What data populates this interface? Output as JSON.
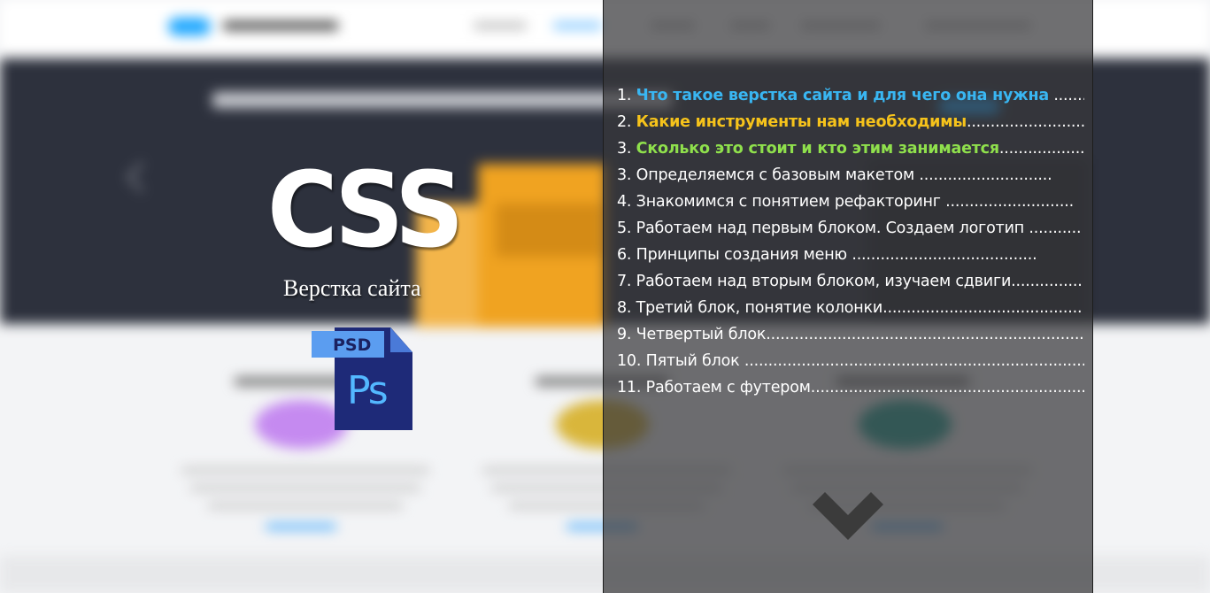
{
  "logo": {
    "title": "CSS",
    "subtitle": "Верстка сайта"
  },
  "psd_icon": {
    "tag": "PSD",
    "label": "Ps",
    "colors": {
      "document": "#1e2a78",
      "tag": "#5b9df0",
      "letters": "#53b8ff"
    }
  },
  "toc": {
    "items": [
      {
        "number": "1.",
        "text": "Что такое верстка сайта и для чего она нужна",
        "dots": " ..............",
        "highlight": "blue"
      },
      {
        "number": "2.",
        "text": "Какие инструменты нам необходимы",
        "dots": "..............................",
        "highlight": "yellow"
      },
      {
        "number": "3.",
        "text": "Сколько это стоит и кто этим занимается",
        "dots": "...................",
        "highlight": "green"
      },
      {
        "number": "3.",
        "text": "Определяемся с базовым макетом",
        "dots": " ............................"
      },
      {
        "number": "4.",
        "text": "Знакомимся с понятием рефакторинг",
        "dots": " ..........................."
      },
      {
        "number": "5.",
        "text": "Работаем над первым блоком. Создаем логотип",
        "dots": " ..........."
      },
      {
        "number": "6.",
        "text": "Принципы создания меню",
        "dots": " ......................................."
      },
      {
        "number": "7.",
        "text": "Работаем над вторым блоком, изучаем сдвиги",
        "dots": "..............."
      },
      {
        "number": "8.",
        "text": "Третий блок, понятие колонки",
        "dots": ".......................................... "
      },
      {
        "number": "9.",
        "text": "Четвертый блок",
        "dots": "........................................................................."
      },
      {
        "number": "10.",
        "text": "Пятый блок",
        "dots": " ..........................................................................."
      },
      {
        "number": "11.",
        "text": "Работаем с футером",
        "dots": "........................................................................"
      }
    ]
  },
  "colors": {
    "highlight_blue": "#39b6f2",
    "highlight_yellow": "#f6c31b",
    "highlight_green": "#8fe04c",
    "panel": "rgba(55,55,58,0.72)",
    "chevron": "#3b3b3b"
  },
  "chevron_icon": "chevron-down-icon"
}
